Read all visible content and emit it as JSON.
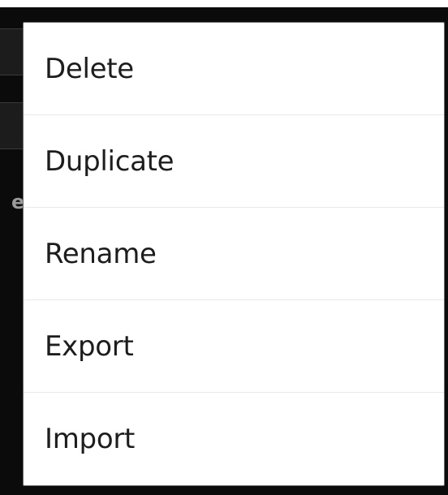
{
  "background": {
    "partial_text": "ea"
  },
  "menu": {
    "items": [
      {
        "label": "Delete"
      },
      {
        "label": "Duplicate"
      },
      {
        "label": "Rename"
      },
      {
        "label": "Export"
      },
      {
        "label": "Import"
      }
    ]
  },
  "colors": {
    "menu_background": "#ffffff",
    "menu_text": "#1d1d1d",
    "divider": "#e9e9e9",
    "backdrop": "#0b0b0b"
  }
}
